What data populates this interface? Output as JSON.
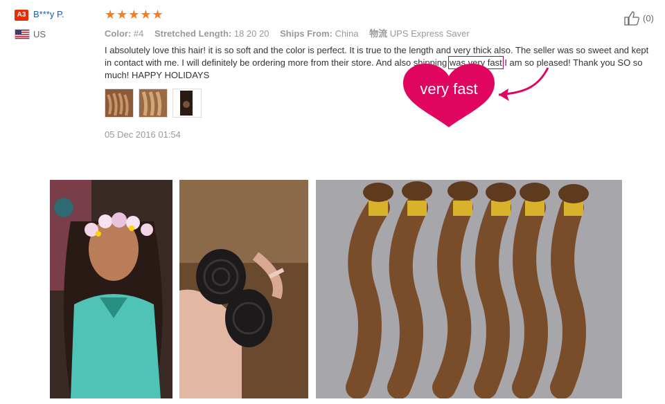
{
  "reviewer": {
    "badge": "A3",
    "name": "B***y P.",
    "country": "US"
  },
  "rating": {
    "stars_text": "★★★★★",
    "value": 5,
    "max": 5
  },
  "attributes": [
    {
      "label": "Color:",
      "value": "#4"
    },
    {
      "label": "Stretched Length:",
      "value": "18 20 20"
    },
    {
      "label": "Ships From:",
      "value": "China"
    },
    {
      "label": "物流",
      "value": "UPS Express Saver"
    }
  ],
  "review": {
    "before": "I absolutely love this hair! it is so soft and the color is perfect. It is true to the length and very thick also. The seller was so sweet and kept in contact with me. I will definitely be ordering more from their store. And also shipping ",
    "highlight": "was very fast",
    "after": " I am so pleased! Thank you SO so much! HAPPY HOLIDAYS"
  },
  "date": "05 Dec 2016 01:54",
  "helpful": {
    "count": "(0)"
  },
  "callout": {
    "text": "very fast",
    "color": "#e0065f"
  },
  "colors": {
    "accent": "#f77c1f",
    "link": "#1a5bb8",
    "badge": "#e62e04"
  }
}
